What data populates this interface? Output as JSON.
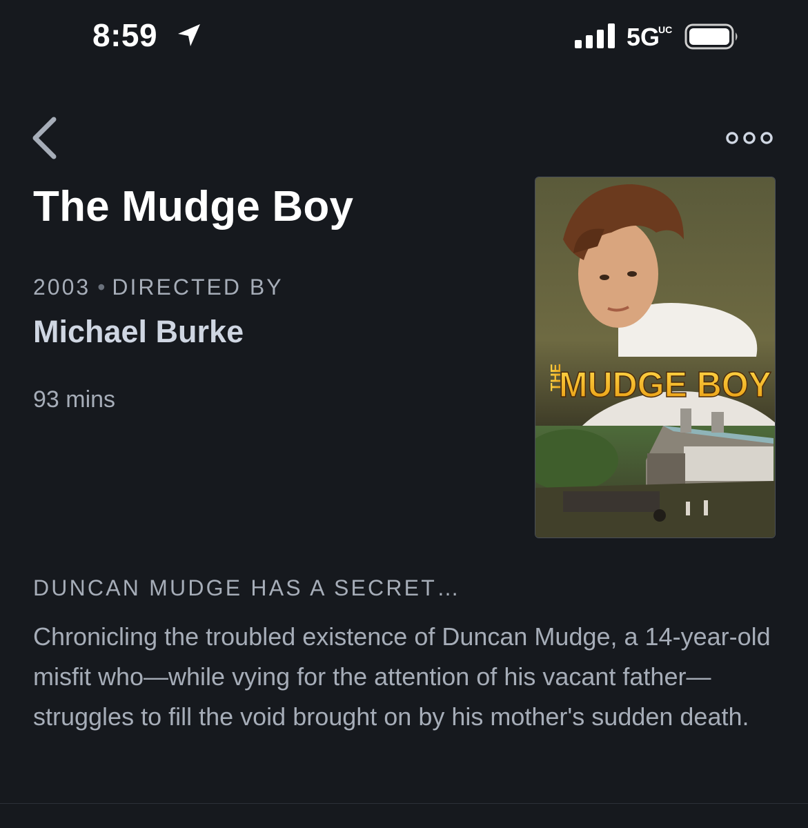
{
  "status_bar": {
    "time": "8:59",
    "network": "5G",
    "network_sub": "UC",
    "icons": [
      "location-arrow-icon",
      "signal-icon",
      "battery-icon"
    ]
  },
  "nav": {
    "back_icon": "chevron-left-icon",
    "more_icon": "more-dots-icon"
  },
  "film": {
    "title": "The Mudge Boy",
    "year": "2003",
    "directed_by_label": "DIRECTED BY",
    "director": "Michael Burke",
    "runtime": "93 mins",
    "poster": {
      "title_prefix": "THE",
      "title_main": "MUDGE BOY"
    },
    "tagline": "DUNCAN MUDGE HAS A SECRET…",
    "synopsis": "Chronicling the troubled existence of Duncan Mudge, a 14-year-old misfit who—while vying for the attention of his vacant father—struggles to fill the void brought on by his mother's sudden death."
  },
  "colors": {
    "background": "#16191e",
    "title": "#ffffff",
    "secondary_text": "#a6adb8",
    "director": "#cfd6e2",
    "poster_title": "#f2b719"
  }
}
